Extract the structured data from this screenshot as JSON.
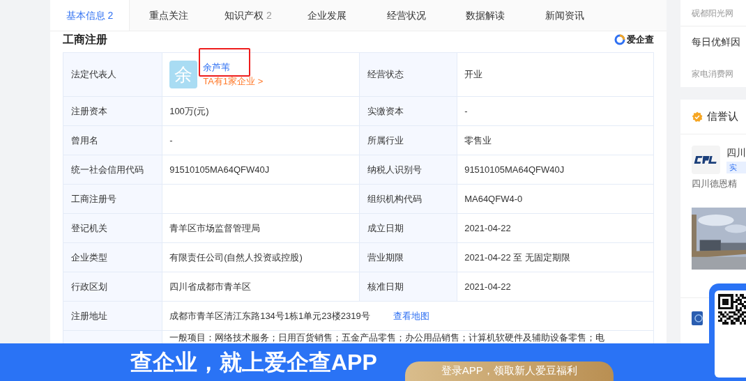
{
  "tabs": [
    {
      "label": "基本信息",
      "count": "2",
      "selected": true
    },
    {
      "label": "重点关注",
      "selected": false
    },
    {
      "label": "知识产权",
      "count": "2",
      "selected": false
    },
    {
      "label": "企业发展",
      "selected": false
    },
    {
      "label": "经营状况",
      "selected": false
    },
    {
      "label": "数据解读",
      "selected": false
    },
    {
      "label": "新闻资讯",
      "selected": false
    }
  ],
  "section": {
    "title": "工商注册",
    "brand": "爱企查"
  },
  "legal_rep": {
    "label": "法定代表人",
    "avatar": "余",
    "name": "余芦苇",
    "link": "TA有1家企业 >",
    "highlighted": true
  },
  "rows": [
    {
      "label": "经营状态",
      "value": "开业"
    },
    {
      "label": "注册资本",
      "value": "100万(元)"
    },
    {
      "label": "实缴资本",
      "value": "-"
    },
    {
      "label": "曾用名",
      "value": "-"
    },
    {
      "label": "所属行业",
      "value": "零售业"
    },
    {
      "label": "统一社会信用代码",
      "value": "91510105MA64QFW40J"
    },
    {
      "label": "纳税人识别号",
      "value": "91510105MA64QFW40J"
    },
    {
      "label": "工商注册号"
    },
    {
      "label": "组织机构代码",
      "value": "MA64QFW4-0"
    },
    {
      "label": "登记机关",
      "value": "青羊区市场监督管理局"
    },
    {
      "label": "成立日期",
      "value": "2021-04-22"
    },
    {
      "label": "企业类型",
      "value": "有限责任公司(自然人投资或控股)"
    },
    {
      "label": "营业期限",
      "value": "2021-04-22 至 无固定期限"
    },
    {
      "label": "行政区划",
      "value": "四川省成都市青羊区"
    },
    {
      "label": "核准日期",
      "value": "2021-04-22"
    }
  ],
  "address": {
    "label": "注册地址",
    "value": "成都市青羊区清江东路134号1栋1单元23楼2319号",
    "link": "查看地图"
  },
  "scope": {
    "value": "一般项目：网络技术服务；日用百货销售；五金产品零售；办公用品销售；计算机软硬件及辅助设备零售；电"
  },
  "sidebar": {
    "news": [
      {
        "kind": "source",
        "text": "砚都阳光网"
      },
      {
        "kind": "title",
        "text": "每日优鲜因"
      },
      {
        "kind": "source",
        "text": "家电消费网"
      }
    ],
    "credit": {
      "title": "信誉认",
      "company": "四川",
      "tag": "实",
      "desc": "四川德恩精"
    }
  },
  "banner": {
    "slogan": "查企业，就上爱企查APP",
    "button": "登录APP，领取新人爱豆福利"
  }
}
